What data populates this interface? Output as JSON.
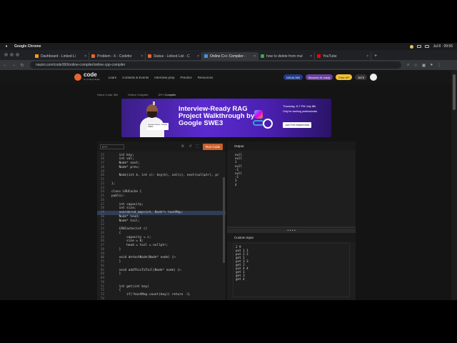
{
  "menubar": {
    "app_name": "Google Chrome",
    "clock": "Jul 8 · 09:56"
  },
  "tabs": [
    {
      "title": "Dashboard - Linked Li",
      "color": "#f59e0b"
    },
    {
      "title": "Problem - X - Codefor",
      "color": "#e8662e"
    },
    {
      "title": "Status - Linked List - C",
      "color": "#e8662e"
    },
    {
      "title": "Online C++ Compiler -",
      "color": "#4a90e2",
      "active": true
    },
    {
      "title": "how to delete from mul",
      "color": "#34a853"
    },
    {
      "title": "YouTube",
      "color": "#ff0000"
    }
  ],
  "address_bar": {
    "url": "naukri.com/code360/online-compiler/online-cpp-compiler"
  },
  "site": {
    "logo_text": "code",
    "logo_sub": "by Coding Ninjas",
    "nav": [
      "Learn",
      "Contests & Events",
      "Interview prep",
      "Practice",
      "Resources"
    ],
    "badges": {
      "coins": "NINJA 360",
      "ai": "Become AI ready",
      "xp": "Free XP",
      "points": "3675"
    }
  },
  "breadcrumbs": [
    "Home Code 360",
    "Online Compiler",
    "C++ Compiler"
  ],
  "banner": {
    "title": "Interview-Ready RAG Project Walkthrough by Google SWE3",
    "date": "Thursday, 8-7 PM July 8th",
    "audience": "Only for working professionals",
    "cta": "Join Free Masterclass",
    "name_tag": "Speaker Name, Google SWE3"
  },
  "editor": {
    "language": "C++",
    "run_label": "Run Code",
    "lines": [
      {
        "n": "15",
        "code": "    int key;"
      },
      {
        "n": "16",
        "code": "    int val;"
      },
      {
        "n": "17",
        "code": "    Node* next;"
      },
      {
        "n": "18",
        "code": "    Node* prev;"
      },
      {
        "n": "19",
        "code": ""
      },
      {
        "n": "20",
        "code": "    Node(int k, int v): key(k), val(v), next(nullptr), pr"
      },
      {
        "n": "21",
        "code": ""
      },
      {
        "n": "22",
        "code": "};"
      },
      {
        "n": "23",
        "code": ""
      },
      {
        "n": "24",
        "code": "class LRUCache {"
      },
      {
        "n": "25",
        "code": "public:"
      },
      {
        "n": "26",
        "code": ""
      },
      {
        "n": "27",
        "code": "    int capacity;"
      },
      {
        "n": "28",
        "code": "    int size;"
      },
      {
        "n": "29",
        "code": "    unordered_map<int, Node*> hashMap;"
      },
      {
        "n": "30",
        "code": "    Node* head;"
      },
      {
        "n": "31",
        "code": "    Node* tail;"
      },
      {
        "n": "32",
        "code": ""
      },
      {
        "n": "33",
        "code": "    LRUCache(int c)"
      },
      {
        "n": "34",
        "code": "    {"
      },
      {
        "n": "35",
        "code": "        capacity = c;"
      },
      {
        "n": "36",
        "code": "        size = 0;"
      },
      {
        "n": "37",
        "code": "        head = tail = nullptr;"
      },
      {
        "n": "38",
        "code": "    }"
      },
      {
        "n": "39",
        "code": ""
      },
      {
        "n": "40",
        "code": "    void detachNode(Node* node) {↔"
      },
      {
        "n": "55",
        "code": "    }"
      },
      {
        "n": "56",
        "code": ""
      },
      {
        "n": "57",
        "code": "    void addThisToTail(Node* node) {↔"
      },
      {
        "n": "68",
        "code": "    }"
      },
      {
        "n": "69",
        "code": ""
      },
      {
        "n": "70",
        "code": ""
      },
      {
        "n": "71",
        "code": "    int get(int key)"
      },
      {
        "n": "72",
        "code": "    {"
      },
      {
        "n": "73",
        "code": "        if(!hashMap.count(key)) return -1;"
      },
      {
        "n": "74",
        "code": ""
      }
    ]
  },
  "output": {
    "title": "Output",
    "text": "null\nnull\n1\nnull\n-1\nnull\n-1\n3\n4"
  },
  "custom_input": {
    "title": "Custom Input",
    "text": "2 9\nput 1 1\nput 2 2\nget 1\nput 3 3\nget 2\nput 4 4\nget 1\nget 3\nget 4"
  }
}
